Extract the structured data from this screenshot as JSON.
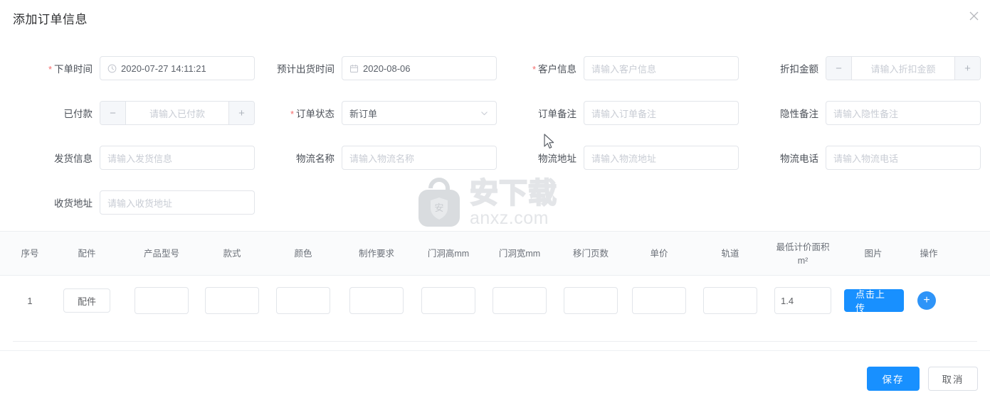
{
  "dialog": {
    "title": "添加订单信息",
    "close_icon": "close-icon"
  },
  "form": {
    "fields": [
      {
        "label": "下单时间",
        "required": true,
        "type": "date-time",
        "value": "2020-07-27 14:11:21",
        "placeholder": "",
        "icon": "clock-icon"
      },
      {
        "label": "预计出货时间",
        "required": false,
        "type": "date",
        "value": "2020-08-06",
        "placeholder": "",
        "icon": "calendar-icon"
      },
      {
        "label": "客户信息",
        "required": true,
        "type": "text",
        "value": "",
        "placeholder": "请输入客户信息",
        "icon": ""
      },
      {
        "label": "折扣金额",
        "required": false,
        "type": "stepper",
        "value": "",
        "placeholder": "请输入折扣金额",
        "minus": "−",
        "plus": "+"
      },
      {
        "label": "已付款",
        "required": false,
        "type": "stepper",
        "value": "",
        "placeholder": "请输入已付款",
        "minus": "−",
        "plus": "+"
      },
      {
        "label": "订单状态",
        "required": true,
        "type": "select",
        "value": "新订单",
        "placeholder": "",
        "icon": "chevron-down-icon"
      },
      {
        "label": "订单备注",
        "required": false,
        "type": "text",
        "value": "",
        "placeholder": "请输入订单备注",
        "icon": ""
      },
      {
        "label": "隐性备注",
        "required": false,
        "type": "text",
        "value": "",
        "placeholder": "请输入隐性备注",
        "icon": ""
      },
      {
        "label": "发货信息",
        "required": false,
        "type": "text",
        "value": "",
        "placeholder": "请输入发货信息",
        "icon": ""
      },
      {
        "label": "物流名称",
        "required": false,
        "type": "text",
        "value": "",
        "placeholder": "请输入物流名称",
        "icon": ""
      },
      {
        "label": "物流地址",
        "required": false,
        "type": "text",
        "value": "",
        "placeholder": "请输入物流地址",
        "icon": ""
      },
      {
        "label": "物流电话",
        "required": false,
        "type": "text",
        "value": "",
        "placeholder": "请输入物流电话",
        "icon": ""
      },
      {
        "label": "收货地址",
        "required": false,
        "type": "text",
        "value": "",
        "placeholder": "请输入收货地址",
        "icon": ""
      }
    ]
  },
  "table": {
    "headers": [
      "序号",
      "配件",
      "产品型号",
      "款式",
      "颜色",
      "制作要求",
      "门洞高mm",
      "门洞宽mm",
      "移门页数",
      "单价",
      "轨道",
      "最低计价面积\nm²",
      "图片",
      "操作"
    ],
    "header_area_label": "最低计价面积",
    "header_area_unit": "m²",
    "rows": [
      {
        "index": "1",
        "parts_button": "配件",
        "product_model": "",
        "style": "",
        "color": "",
        "requirement": "",
        "door_height": "",
        "door_width": "",
        "door_pages": "",
        "unit_price": "",
        "track": "",
        "min_area": "1.4",
        "upload_button": "点击上传",
        "add_button": "+"
      }
    ]
  },
  "footer": {
    "save_label": "保存",
    "cancel_label": "取消"
  },
  "watermark": {
    "cn": "安下载",
    "en": "anxz.com",
    "shield_char": "安"
  },
  "colors": {
    "primary": "#1890ff",
    "required_star": "#f56c6c",
    "text": "#303133",
    "placeholder": "#c8ccd4",
    "border": "#e2e5ea"
  }
}
